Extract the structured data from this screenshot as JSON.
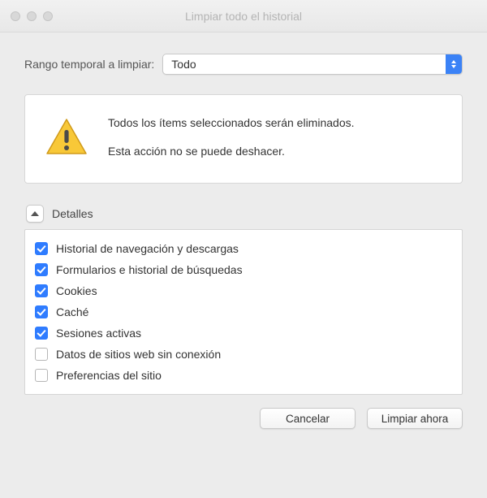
{
  "window": {
    "title": "Limpiar todo el historial"
  },
  "range": {
    "label": "Rango temporal a limpiar:",
    "selected": "Todo"
  },
  "warning": {
    "line1": "Todos los ítems seleccionados serán eliminados.",
    "line2": "Esta acción no se puede deshacer."
  },
  "details": {
    "label": "Detalles",
    "expanded": true,
    "options": [
      {
        "label": "Historial de navegación y descargas",
        "checked": true
      },
      {
        "label": "Formularios e historial de búsquedas",
        "checked": true
      },
      {
        "label": "Cookies",
        "checked": true
      },
      {
        "label": "Caché",
        "checked": true
      },
      {
        "label": "Sesiones activas",
        "checked": true
      },
      {
        "label": "Datos de sitios web sin conexión",
        "checked": false
      },
      {
        "label": "Preferencias del sitio",
        "checked": false
      }
    ]
  },
  "buttons": {
    "cancel": "Cancelar",
    "clear": "Limpiar ahora"
  }
}
